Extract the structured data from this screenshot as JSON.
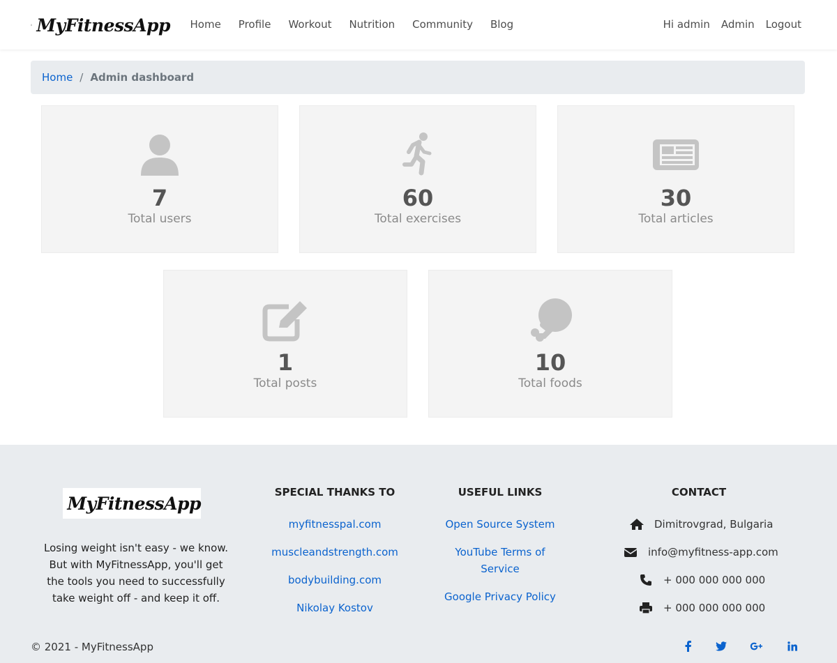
{
  "brand": {
    "name": "MyFitnessApp"
  },
  "nav": {
    "items": [
      {
        "label": "Home"
      },
      {
        "label": "Profile"
      },
      {
        "label": "Workout"
      },
      {
        "label": "Nutrition"
      },
      {
        "label": "Community"
      },
      {
        "label": "Blog"
      }
    ],
    "greeting": "Hi admin",
    "admin": "Admin",
    "logout": "Logout"
  },
  "breadcrumb": {
    "home": "Home",
    "separator": "/",
    "current": "Admin dashboard"
  },
  "stats": [
    {
      "icon": "user-icon",
      "value": "7",
      "label": "Total users"
    },
    {
      "icon": "running-icon",
      "value": "60",
      "label": "Total exercises"
    },
    {
      "icon": "newspaper-icon",
      "value": "30",
      "label": "Total articles"
    },
    {
      "icon": "edit-icon",
      "value": "1",
      "label": "Total posts"
    },
    {
      "icon": "drumstick-icon",
      "value": "10",
      "label": "Total foods"
    }
  ],
  "footer": {
    "description": "Losing weight isn't easy - we know. But with MyFitnessApp, you'll get the tools you need to successfully take weight off - and keep it off.",
    "thanks": {
      "title": "SPECIAL THANKS TO",
      "links": [
        "myfitnesspal.com",
        "muscleandstrength.com",
        "bodybuilding.com",
        "Nikolay Kostov"
      ]
    },
    "useful": {
      "title": "USEFUL LINKS",
      "links": [
        "Open Source System",
        "YouTube Terms of Service",
        "Google Privacy Policy"
      ]
    },
    "contact": {
      "title": "CONTACT",
      "address": "Dimitrovgrad, Bulgaria",
      "email": "info@myfitness-app.com",
      "phone": "+ 000 000 000 000",
      "fax": "+ 000 000 000 000"
    },
    "copyright": "© 2021 - MyFitnessApp",
    "socials": [
      "facebook-icon",
      "twitter-icon",
      "google-plus-icon",
      "linkedin-icon"
    ]
  },
  "colors": {
    "link": "#0b63ce",
    "card_bg": "#f4f4f4",
    "icon_gray": "#c4c4c4",
    "footer_bg": "#e9ecef"
  }
}
